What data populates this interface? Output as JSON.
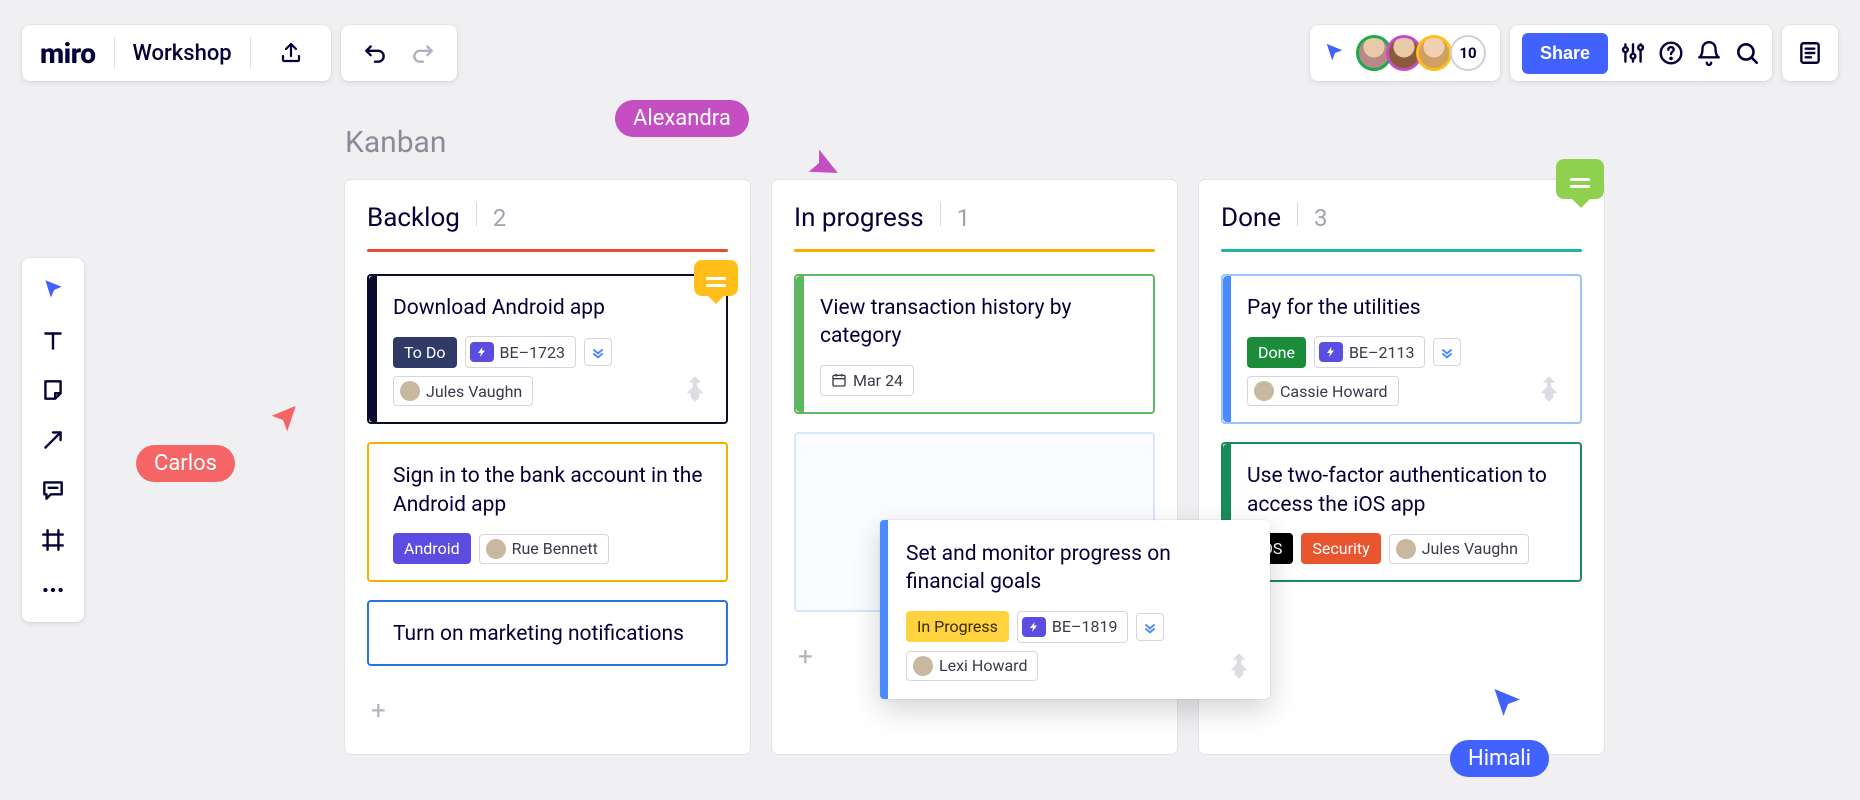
{
  "app": {
    "logo": "miro",
    "board_name": "Workshop"
  },
  "presence": {
    "extra_count": "10",
    "share_label": "Share"
  },
  "board": {
    "title": "Kanban",
    "columns": [
      {
        "name": "Backlog",
        "count": "2",
        "underline": "u-red"
      },
      {
        "name": "In progress",
        "count": "1",
        "underline": "u-yellow"
      },
      {
        "name": "Done",
        "count": "3",
        "underline": "u-teal"
      }
    ]
  },
  "cards": {
    "backlog": [
      {
        "title": "Download Android app",
        "status": {
          "label": "To Do",
          "style": "chip-dark"
        },
        "ticket": "BE–1723",
        "assignee": "Jules Vaughn",
        "has_priority": true,
        "has_jira": true
      },
      {
        "title": "Sign in to the bank account in the Android app",
        "status": {
          "label": "Android",
          "style": "chip-purple"
        },
        "assignee": "Rue Bennett"
      },
      {
        "title": "Turn on marketing notifications"
      }
    ],
    "inprogress": [
      {
        "title": "View transaction history by category",
        "date": "Mar 24"
      }
    ],
    "done": [
      {
        "title": "Pay for the utilities",
        "status": {
          "label": "Done",
          "style": "chip-green"
        },
        "ticket": "BE–2113",
        "assignee": "Cassie Howard",
        "has_priority": true,
        "has_jira": true
      },
      {
        "title": "Use two-factor authentication to access the iOS app",
        "tags": [
          {
            "label": "iOS",
            "style": "chip-black"
          },
          {
            "label": "Security",
            "style": "chip-orange"
          }
        ],
        "assignee": "Jules Vaughn"
      }
    ]
  },
  "drag_card": {
    "title": "Set and monitor progress on financial goals",
    "status": {
      "label": "In Progress",
      "style": "chip-yellow"
    },
    "ticket": "BE–1819",
    "assignee": "Lexi Howard",
    "has_priority": true,
    "has_jira": true
  },
  "cursors": {
    "carlos": {
      "name": "Carlos",
      "color": "#f56565"
    },
    "alexandra": {
      "name": "Alexandra",
      "color": "#c34fc3"
    },
    "himali": {
      "name": "Himali",
      "color": "#4262ff"
    }
  },
  "avatar_colors": [
    "#1aab4a",
    "#c34fc3",
    "#ffbe1a"
  ]
}
